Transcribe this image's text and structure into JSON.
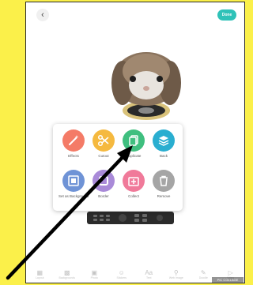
{
  "header": {
    "back_glyph": "‹",
    "done_label": "Done"
  },
  "colors": {
    "background": "#fbf04a",
    "done": "#2fc2b8"
  },
  "menu": {
    "items": [
      {
        "label": "Effects",
        "icon": "magic-wand-icon",
        "color": "#f47b67"
      },
      {
        "label": "Cutout",
        "icon": "scissors-icon",
        "color": "#f5b93f"
      },
      {
        "label": "Duplicate",
        "icon": "duplicate-icon",
        "color": "#3fbf7f"
      },
      {
        "label": "Back",
        "icon": "layers-icon",
        "color": "#2aaed0"
      },
      {
        "label": "Set as Background",
        "icon": "set-background-icon",
        "color": "#6f93d6"
      },
      {
        "label": "Border",
        "icon": "border-icon",
        "color": "#a98ad8"
      },
      {
        "label": "Collect",
        "icon": "collect-icon",
        "color": "#f07a9a"
      },
      {
        "label": "Remove",
        "icon": "trash-icon",
        "color": "#a5a5a5"
      }
    ]
  },
  "toolbar": {
    "items": [
      {
        "label": "Layout"
      },
      {
        "label": "Backgrounds"
      },
      {
        "label": "Photo"
      },
      {
        "label": "Stickers"
      },
      {
        "label": "Text"
      },
      {
        "label": "Web Image"
      },
      {
        "label": "Doodle"
      },
      {
        "label": "Video"
      }
    ]
  },
  "watermark": "PIC COLLAGE"
}
